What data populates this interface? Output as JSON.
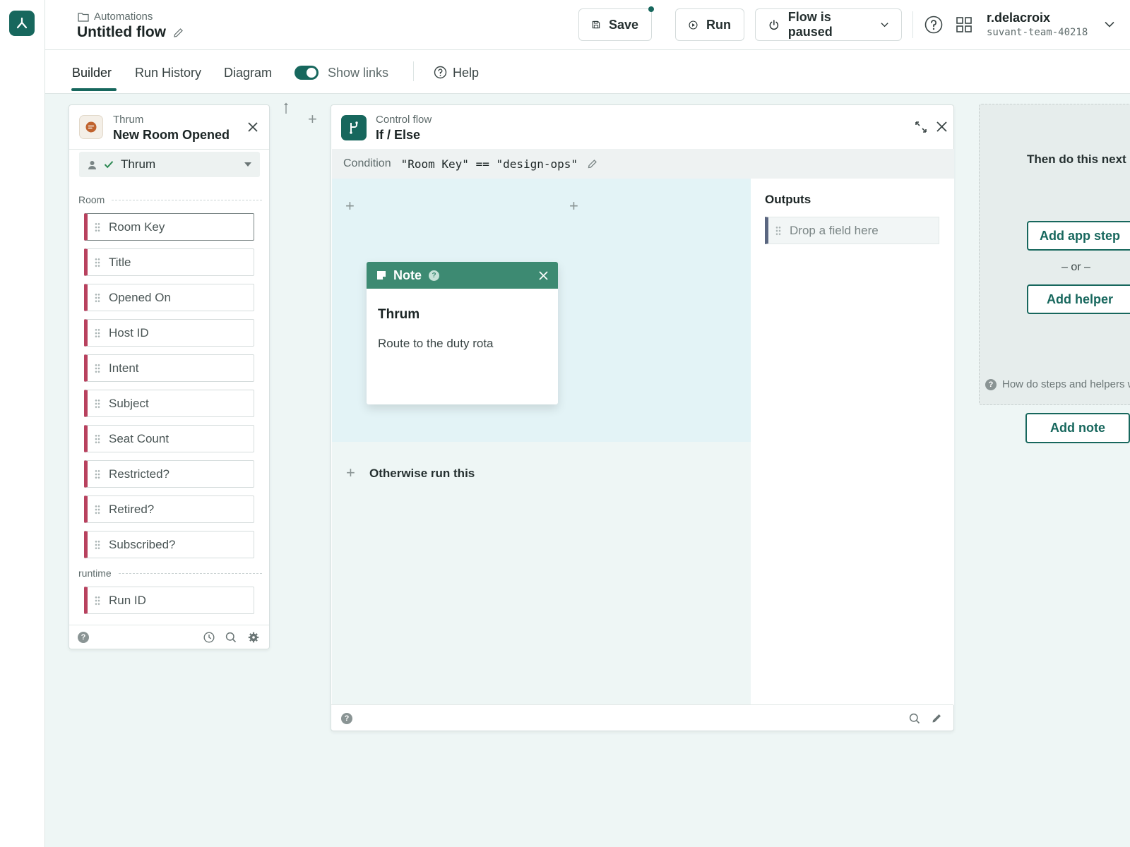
{
  "header": {
    "breadcrumb": "Automations",
    "flow_title": "Untitled flow",
    "save_label": "Save",
    "run_label": "Run",
    "status_label": "Flow is paused",
    "user_name": "r.delacroix",
    "team_id": "suvant-team-40218"
  },
  "tabs": {
    "builder": "Builder",
    "run_history": "Run History",
    "diagram": "Diagram",
    "show_links": "Show links",
    "help": "Help"
  },
  "trigger": {
    "app": "Thrum",
    "event": "New Room Opened",
    "account": "Thrum",
    "group_room": "Room",
    "fields": [
      "Room Key",
      "Title",
      "Opened On",
      "Host ID",
      "Intent",
      "Subject",
      "Seat Count",
      "Restricted?",
      "Retired?",
      "Subscribed?"
    ],
    "group_runtime": "runtime",
    "runtime_fields": [
      "Run ID"
    ]
  },
  "control": {
    "category": "Control flow",
    "title": "If / Else",
    "condition_label": "Condition",
    "condition_expr": "\"Room Key\" == \"design-ops\"",
    "note_label": "Note",
    "note_title": "Thrum",
    "note_body": "Route to the duty rota",
    "otherwise_label": "Otherwise run this",
    "outputs_label": "Outputs",
    "drop_placeholder": "Drop a field here"
  },
  "next_panel": {
    "title": "Then do this next",
    "add_app_step": "Add app step",
    "or_text": "– or –",
    "add_helper": "Add helper",
    "help_text": "How do steps and helpers work?",
    "add_note": "Add note"
  },
  "colors": {
    "brand": "#17675d",
    "field_accent": "#b8415e",
    "note_header": "#3d8a72",
    "then_bg": "#e3f3f6"
  }
}
